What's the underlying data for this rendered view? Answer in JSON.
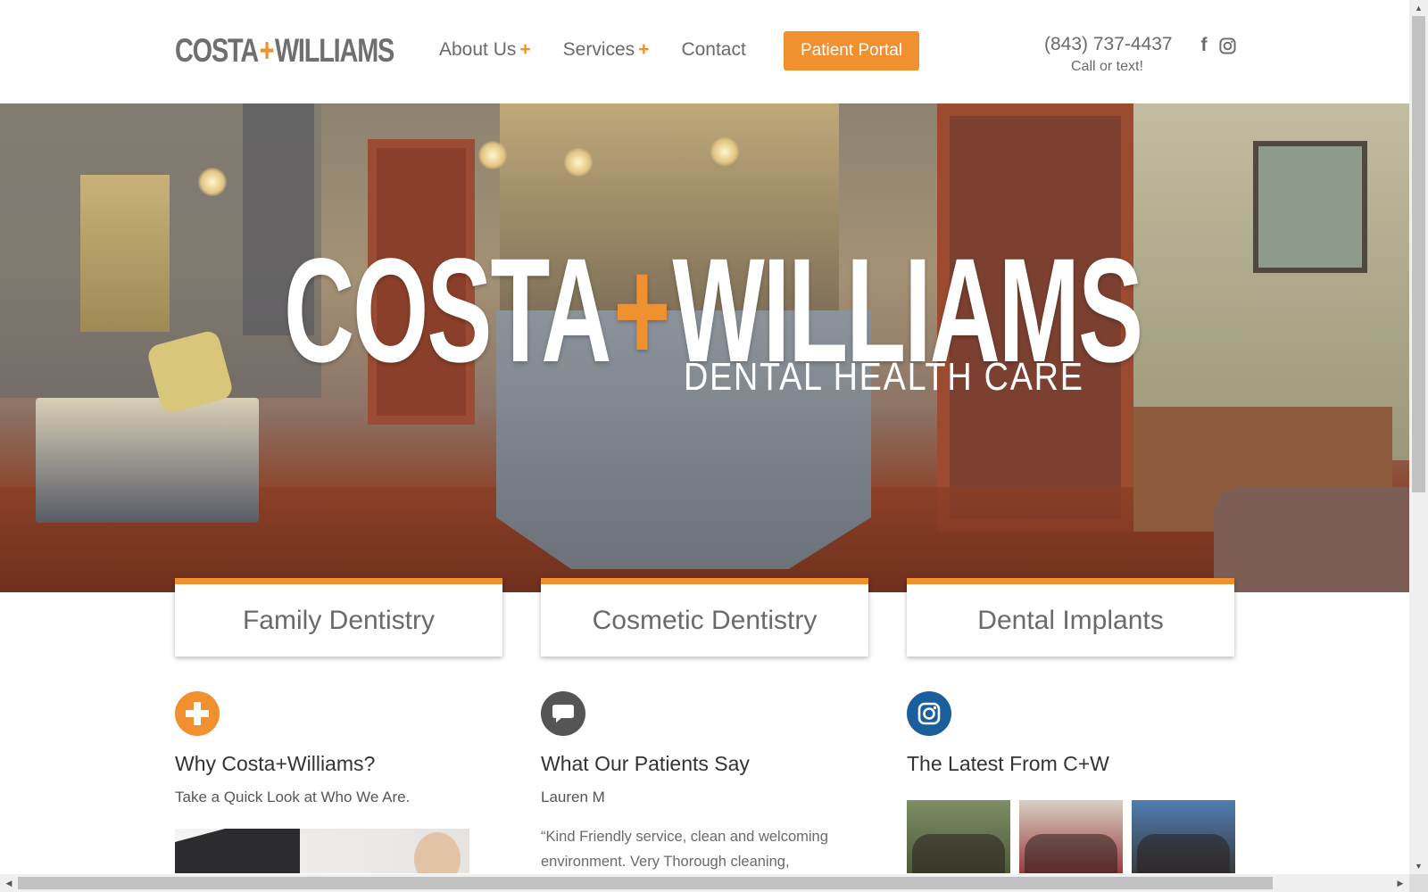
{
  "header": {
    "logo": {
      "left": "COSTA",
      "plus": "+",
      "right": "WILLIAMS"
    },
    "nav": [
      {
        "label": "About Us",
        "plus": "+"
      },
      {
        "label": "Services",
        "plus": "+"
      },
      {
        "label": "Contact",
        "plus": ""
      }
    ],
    "portal_button": "Patient Portal",
    "phone": "(843) 737-4437",
    "call_text": "Call or text!",
    "social": [
      "facebook-icon",
      "instagram-icon"
    ]
  },
  "hero": {
    "title_left": "COSTA",
    "title_plus": "+",
    "title_right": "WILLIAMS",
    "subtitle": "DENTAL HEALTH CARE"
  },
  "services": [
    "Family Dentistry",
    "Cosmetic Dentistry",
    "Dental Implants"
  ],
  "columns": [
    {
      "icon": "plus-circle-icon",
      "title": "Why Costa+Williams?",
      "subtitle": "Take a Quick Look at Who We Are."
    },
    {
      "icon": "speech-bubble-icon",
      "title": "What Our Patients Say",
      "subtitle": "Lauren M",
      "quote": "“Kind Friendly service, clean and welcoming environment. Very Thorough cleaning,"
    },
    {
      "icon": "instagram-icon",
      "title": "The Latest From C+W"
    }
  ],
  "colors": {
    "accent": "#f0902f",
    "text_gray": "#6a6a6a",
    "speech_icon": "#555555",
    "instagram_blue": "#1a5e9c"
  }
}
